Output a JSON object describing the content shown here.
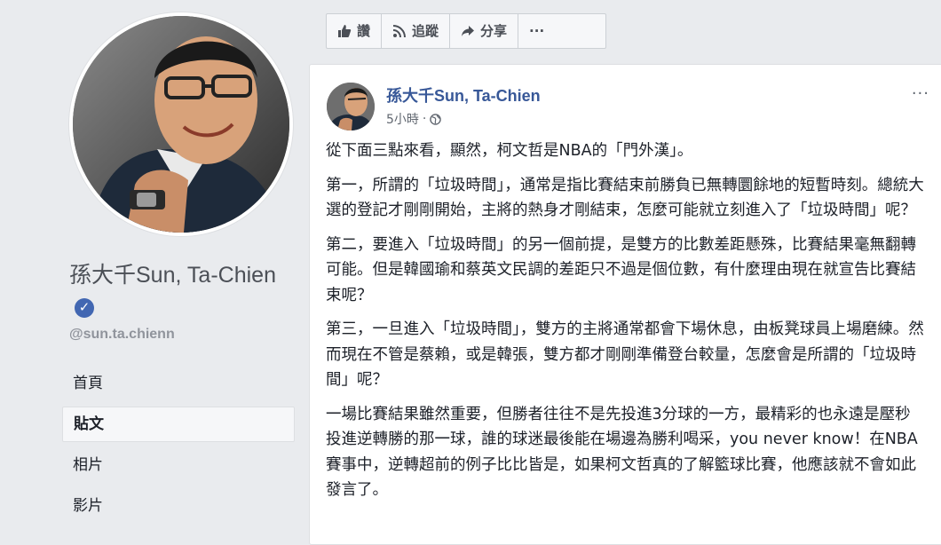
{
  "colors": {
    "brand_blue": "#4267b2",
    "link_blue": "#385898",
    "background": "#e9ebee"
  },
  "sidebar": {
    "page_name": "孫大千Sun, Ta-Chien",
    "handle": "@sun.ta.chienn",
    "verified_icon": "verified-badge-icon",
    "nav": [
      {
        "label": "首頁",
        "active": false
      },
      {
        "label": "貼文",
        "active": true
      },
      {
        "label": "相片",
        "active": false
      },
      {
        "label": "影片",
        "active": false
      }
    ]
  },
  "actions": {
    "like_label": "讚",
    "follow_label": "追蹤",
    "share_label": "分享",
    "more_label": "···"
  },
  "post": {
    "author": "孫大千Sun, Ta-Chien",
    "time": "5小時",
    "more": "···",
    "paragraphs": [
      "從下面三點來看，顯然，柯文哲是NBA的「門外漢」。",
      "第一，所謂的「垃圾時間」，通常是指比賽結束前勝負已無轉圜餘地的短暫時刻。總統大選的登記才剛剛開始，主將的熱身才剛結束，怎麼可能就立刻進入了「垃圾時間」呢？",
      "第二，要進入「垃圾時間」的另一個前提，是雙方的比數差距懸殊，比賽結果毫無翻轉可能。但是韓國瑜和蔡英文民調的差距只不過是個位數，有什麼理由現在就宣告比賽結束呢？",
      "第三，一旦進入「垃圾時間」，雙方的主將通常都會下場休息，由板凳球員上場磨練。然而現在不管是蔡賴，或是韓張，雙方都才剛剛準備登台較量，怎麼會是所謂的「垃圾時間」呢？",
      "一場比賽結果雖然重要，但勝者往往不是先投進3分球的一方，最精彩的也永遠是壓秒投進逆轉勝的那一球，誰的球迷最後能在場邊為勝利喝采，you never know！在NBA賽事中，逆轉超前的例子比比皆是，如果柯文哲真的了解籃球比賽，他應該就不會如此發言了。"
    ]
  }
}
